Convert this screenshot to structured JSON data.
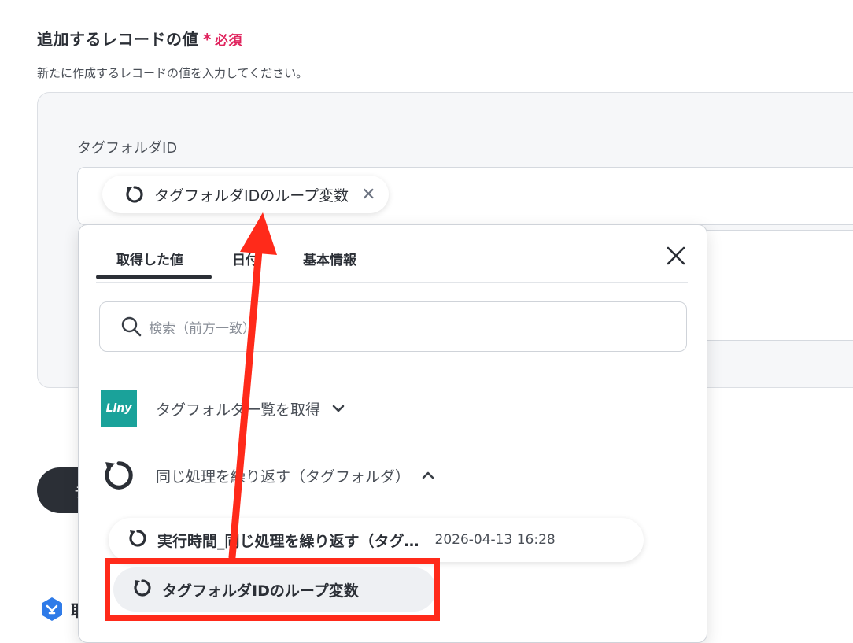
{
  "section": {
    "title": "追加するレコードの値",
    "required_mark": "*",
    "required_text": "必須",
    "description": "新たに作成するレコードの値を入力してください。"
  },
  "field": {
    "label": "タグフォルダID",
    "chip_label": "タグフォルダIDのループ変数",
    "chip_close": "✕"
  },
  "dropdown": {
    "tabs": [
      {
        "label": "取得した値",
        "active": true
      },
      {
        "label": "日付",
        "active": false
      },
      {
        "label": "基本情報",
        "active": false
      }
    ],
    "search_placeholder": "検索（前方一致）",
    "groups": [
      {
        "label": "タグフォルダ一覧を取得",
        "logo_text": "Liny",
        "expanded": false,
        "chevron": "⌄"
      },
      {
        "label": "同じ処理を繰り返す（タグフォルダ）",
        "expanded": true,
        "chevron": "⌃"
      }
    ],
    "items": [
      {
        "label": "実行時間_同じ処理を繰り返す（タグ…",
        "value": "2026-04-13 16:28"
      },
      {
        "label": "タグフォルダIDのループ変数",
        "value": ""
      }
    ]
  },
  "background": {
    "button_text": "テ",
    "bottom_text": "取"
  },
  "colors": {
    "accent_required": "#e0245e",
    "liny_brand": "#1aa29a",
    "highlight": "#ff2a1a",
    "dark": "#2b2f36"
  }
}
